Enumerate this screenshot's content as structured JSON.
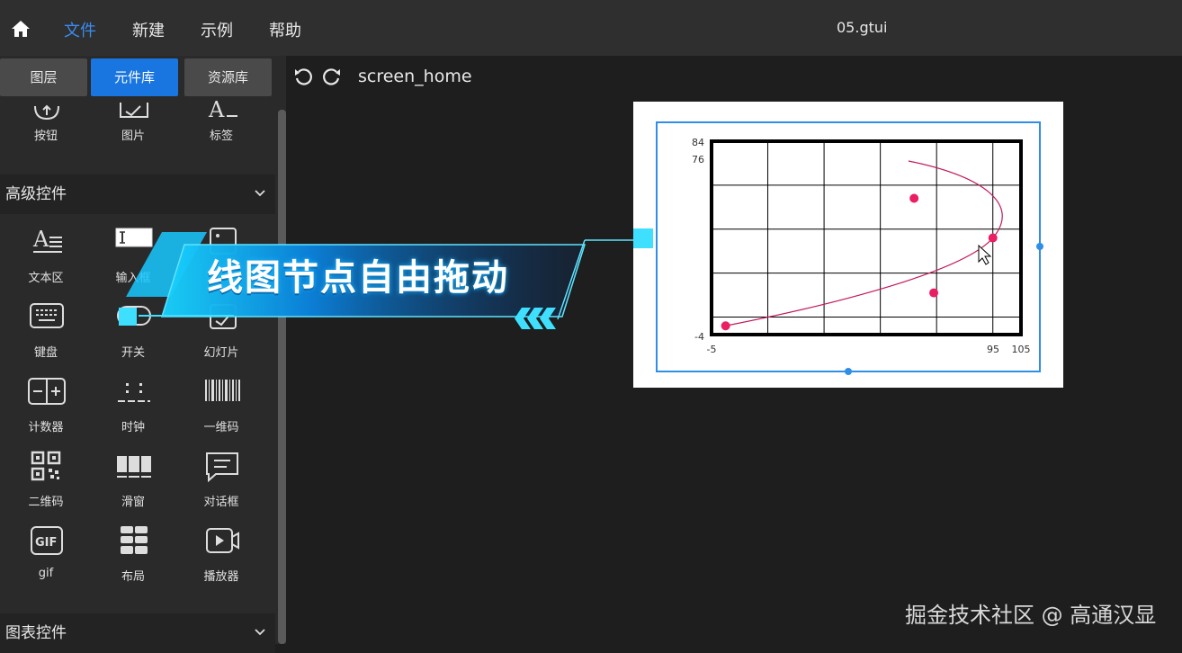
{
  "topbar": {
    "menu": [
      "文件",
      "新建",
      "示例",
      "帮助"
    ],
    "active_menu": "文件",
    "filename": "05.gtui"
  },
  "leftpanel": {
    "tabs": [
      "图层",
      "元件库",
      "资源库"
    ],
    "active_tab": "元件库",
    "basic_row": [
      {
        "label": "按钮",
        "icon": "button-icon"
      },
      {
        "label": "图片",
        "icon": "image-icon"
      },
      {
        "label": "标签",
        "icon": "label-icon"
      }
    ],
    "sections": {
      "advanced": "高级控件",
      "charts": "图表控件"
    },
    "advanced_items": [
      {
        "label": "文本区",
        "icon": "textarea-icon"
      },
      {
        "label": "输入框",
        "icon": "input-icon"
      },
      {
        "label": "",
        "icon": "image-button-icon"
      },
      {
        "label": "键盘",
        "icon": "keyboard-icon"
      },
      {
        "label": "开关",
        "icon": "switch-icon"
      },
      {
        "label": "幻灯片",
        "icon": "slideshow-icon"
      },
      {
        "label": "计数器",
        "icon": "counter-icon"
      },
      {
        "label": "时钟",
        "icon": "clock-icon"
      },
      {
        "label": "一维码",
        "icon": "barcode-icon"
      },
      {
        "label": "二维码",
        "icon": "qrcode-icon"
      },
      {
        "label": "滑窗",
        "icon": "slider-window-icon"
      },
      {
        "label": "对话框",
        "icon": "dialog-icon"
      },
      {
        "label": "gif",
        "icon": "gif-icon"
      },
      {
        "label": "布局",
        "icon": "layout-icon"
      },
      {
        "label": "播放器",
        "icon": "player-icon"
      }
    ]
  },
  "canvas": {
    "screen_name": "screen_home",
    "banner_text": "线图节点自由拖动"
  },
  "chart_data": {
    "type": "line",
    "xlim": [
      -5,
      105
    ],
    "ylim": [
      -4,
      84
    ],
    "x_ticks": [
      "-5",
      "95",
      "105"
    ],
    "y_ticks": [
      "84",
      "76",
      "-4"
    ],
    "grid": true,
    "points": [
      {
        "x": 0,
        "y": 0
      },
      {
        "x": 67,
        "y": 58
      },
      {
        "x": 74,
        "y": 15
      },
      {
        "x": 95,
        "y": 40
      }
    ],
    "line_color": "#c2185b"
  },
  "watermark": "掘金技术社区 @ 高通汉显"
}
